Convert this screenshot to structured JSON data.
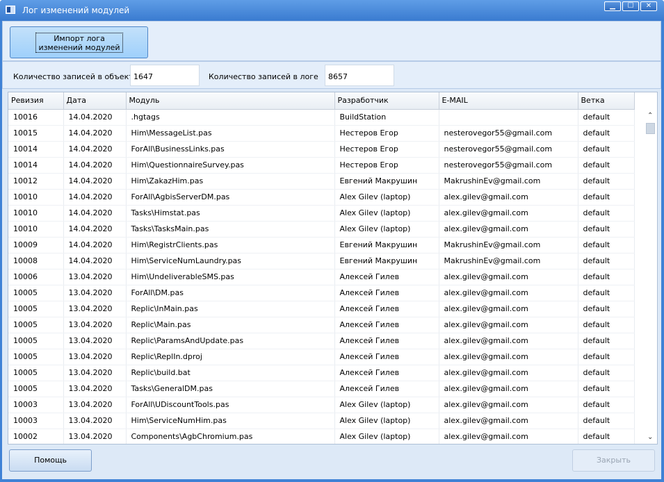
{
  "window": {
    "title": "Лог изменений модулей",
    "controls": [
      "minimize",
      "maximize",
      "close"
    ]
  },
  "toolbar": {
    "import_label": "Импорт лога изменений модулей"
  },
  "counts": {
    "object_label": "Количество записей в объекте",
    "object_value": "1647",
    "log_label": "Количество записей в логе",
    "log_value": "8657"
  },
  "table": {
    "columns": [
      "Ревизия",
      "Дата",
      "Модуль",
      "Разработчик",
      "E-MAIL",
      "Ветка"
    ],
    "rows": [
      [
        "10016",
        "14.04.2020",
        ".hgtags",
        "BuildStation",
        "",
        "default"
      ],
      [
        "10015",
        "14.04.2020",
        "Him\\MessageList.pas",
        "Нестеров Егор",
        "nesterovegor55@gmail.com",
        "default"
      ],
      [
        "10014",
        "14.04.2020",
        "ForAll\\BusinessLinks.pas",
        "Нестеров Егор",
        "nesterovegor55@gmail.com",
        "default"
      ],
      [
        "10014",
        "14.04.2020",
        "Him\\QuestionnaireSurvey.pas",
        "Нестеров Егор",
        "nesterovegor55@gmail.com",
        "default"
      ],
      [
        "10012",
        "14.04.2020",
        "Him\\ZakazHim.pas",
        "Евгений Макрушин",
        "MakrushinEv@gmail.com",
        "default"
      ],
      [
        "10010",
        "14.04.2020",
        "ForAll\\AgbisServerDM.pas",
        "Alex Gilev (laptop)",
        "alex.gilev@gmail.com",
        "default"
      ],
      [
        "10010",
        "14.04.2020",
        "Tasks\\Himstat.pas",
        "Alex Gilev (laptop)",
        "alex.gilev@gmail.com",
        "default"
      ],
      [
        "10010",
        "14.04.2020",
        "Tasks\\TasksMain.pas",
        "Alex Gilev (laptop)",
        "alex.gilev@gmail.com",
        "default"
      ],
      [
        "10009",
        "14.04.2020",
        "Him\\RegistrClients.pas",
        "Евгений Макрушин",
        "MakrushinEv@gmail.com",
        "default"
      ],
      [
        "10008",
        "14.04.2020",
        "Him\\ServiceNumLaundry.pas",
        "Евгений Макрушин",
        "MakrushinEv@gmail.com",
        "default"
      ],
      [
        "10006",
        "13.04.2020",
        "Him\\UndeliverableSMS.pas",
        "Алексей Гилев",
        "alex.gilev@gmail.com",
        "default"
      ],
      [
        "10005",
        "13.04.2020",
        "ForAll\\DM.pas",
        "Алексей Гилев",
        "alex.gilev@gmail.com",
        "default"
      ],
      [
        "10005",
        "13.04.2020",
        "Replic\\InMain.pas",
        "Алексей Гилев",
        "alex.gilev@gmail.com",
        "default"
      ],
      [
        "10005",
        "13.04.2020",
        "Replic\\Main.pas",
        "Алексей Гилев",
        "alex.gilev@gmail.com",
        "default"
      ],
      [
        "10005",
        "13.04.2020",
        "Replic\\ParamsAndUpdate.pas",
        "Алексей Гилев",
        "alex.gilev@gmail.com",
        "default"
      ],
      [
        "10005",
        "13.04.2020",
        "Replic\\ReplIn.dproj",
        "Алексей Гилев",
        "alex.gilev@gmail.com",
        "default"
      ],
      [
        "10005",
        "13.04.2020",
        "Replic\\build.bat",
        "Алексей Гилев",
        "alex.gilev@gmail.com",
        "default"
      ],
      [
        "10005",
        "13.04.2020",
        "Tasks\\GeneralDM.pas",
        "Алексей Гилев",
        "alex.gilev@gmail.com",
        "default"
      ],
      [
        "10003",
        "13.04.2020",
        "ForAll\\UDiscountTools.pas",
        "Alex Gilev (laptop)",
        "alex.gilev@gmail.com",
        "default"
      ],
      [
        "10003",
        "13.04.2020",
        "Him\\ServiceNumHim.pas",
        "Alex Gilev (laptop)",
        "alex.gilev@gmail.com",
        "default"
      ],
      [
        "10002",
        "13.04.2020",
        "Components\\AgbChromium.pas",
        "Alex Gilev (laptop)",
        "alex.gilev@gmail.com",
        "default"
      ]
    ]
  },
  "footer": {
    "help_label": "Помощь",
    "close_label": "Закрыть"
  }
}
